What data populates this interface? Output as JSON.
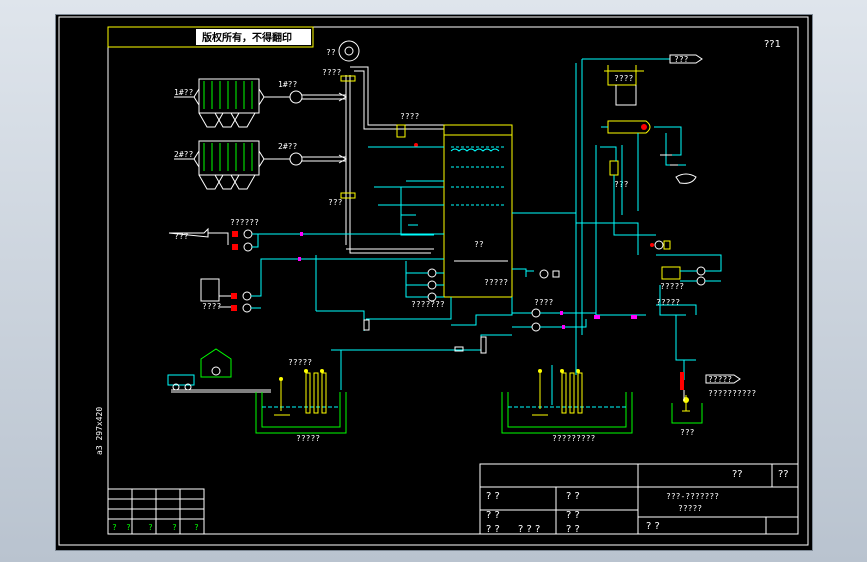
{
  "app": {
    "background": "#c9d1da",
    "canvas_color": "#000000",
    "line_color": "#00ffff",
    "frame_color": "#ffffff",
    "accent_yellow": "#ffff00",
    "accent_green": "#00ff00",
    "accent_magenta": "#ff00ff",
    "accent_red": "#ff0000"
  },
  "drawing": {
    "copyright_note": "版权所有，不得翻印",
    "sheet_no": "??1",
    "side_label": "a3 297x420",
    "labels": {
      "inlet1": "1#??",
      "inlet2": "2#??",
      "fan1": "1#??",
      "fan2": "2#??",
      "blower": "??",
      "damper_top": "????",
      "damper_bottom": "???",
      "valve_mid": "????",
      "water_tank": "???",
      "pump_group1": "??????",
      "dosing_tank": "????",
      "tower": "??",
      "tower_bottom": "?????",
      "pump_group2": "???????",
      "pump_right": "????",
      "pond_left_title": "?????",
      "pond_left": "?????",
      "pond_right": "?????????",
      "top_right_tag": "???",
      "filter_tag": "????",
      "right_tank": "???",
      "right_pumps": "?????",
      "right_small": "?????",
      "right_arrow_tag": "?????",
      "right_small2": "??????????",
      "bottom_pit": "???"
    }
  },
  "title_block": {
    "header_right": "??",
    "header_mark": "??",
    "row1_left": "? ?",
    "row1_mid": "? ?",
    "row2_left": "? ?",
    "row2_mid": "? ?",
    "row3_left": "? ?",
    "row3_mid1": "? ? ?",
    "row3_mid2": "? ?",
    "name_line1": "???-???????",
    "name_line2": "?????",
    "scale_label": "?  ?"
  },
  "revision_block": {
    "cells": [
      "?",
      "?",
      "?",
      "?",
      "?"
    ]
  }
}
